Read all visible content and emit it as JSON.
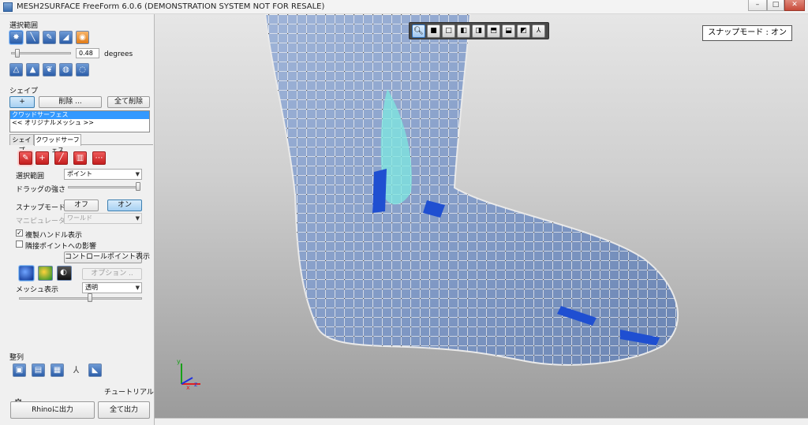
{
  "window": {
    "title": "MESH2SURFACE FreeForm 6.0.6 (DEMONSTRATION SYSTEM NOT FOR RESALE)",
    "controls": {
      "minimize": "–",
      "maximize": "□",
      "close": "✕"
    }
  },
  "panel": {
    "selection_range_label": "選択範囲",
    "selection_tools": [
      {
        "icon": "select-point-icon",
        "selected": true
      },
      {
        "icon": "select-edge-icon",
        "selected": false
      },
      {
        "icon": "select-brush-icon",
        "selected": false
      },
      {
        "icon": "select-region-icon",
        "selected": false
      },
      {
        "icon": "select-lasso-icon",
        "selected": false
      }
    ],
    "angle_value": "0.48",
    "angle_unit": "degrees",
    "angle_slider_position": 0.06,
    "mesh_tools": [
      {
        "icon": "triangle-outline-icon"
      },
      {
        "icon": "triangle-filled-icon"
      },
      {
        "icon": "bird-icon"
      },
      {
        "icon": "bulb-icon"
      },
      {
        "icon": "bulb-bright-icon"
      }
    ],
    "shape_section_label": "シェイプ",
    "add_label": "+",
    "delete_label": "削除 ...",
    "delete_all_label": "全て削除",
    "shapes_list": [
      {
        "label": "クワッドサーフェス",
        "selected": true
      },
      {
        "label": "<< オリジナルメッシュ >>",
        "selected": false
      }
    ],
    "tabs": [
      {
        "label": "シェイプ",
        "active": false
      },
      {
        "label": "クワッドサーフェス",
        "active": true
      }
    ],
    "quad_tools": [
      {
        "icon": "quad-brush-icon",
        "selected": true
      },
      {
        "icon": "quad-add-icon",
        "selected": false
      },
      {
        "icon": "quad-line-icon",
        "selected": false
      },
      {
        "icon": "quad-split-icon",
        "selected": false
      },
      {
        "icon": "quad-dots-icon",
        "selected": false
      }
    ],
    "selection_range": {
      "label": "選択範囲",
      "value": "ポイント"
    },
    "drag_strength": {
      "label": "ドラッグの強さ",
      "slider_position": 0.97
    },
    "snap_mode": {
      "label": "スナップモード",
      "off_label": "オフ",
      "on_label": "オン",
      "state": "on"
    },
    "manipulator": {
      "label": "マニピュレータ",
      "value": "ワールド"
    },
    "duplicate_handles": {
      "label": "複製ハンドル表示",
      "checked": true
    },
    "adjacent_points": {
      "label": "隣接ポイントへの影響",
      "checked": false
    },
    "control_points_button": "コントロールポイント表示",
    "display_modes": [
      {
        "icon": "shaded-sphere-icon",
        "selected": true
      },
      {
        "icon": "color-sphere-icon",
        "selected": false
      },
      {
        "icon": "wire-sphere-icon",
        "selected": false
      }
    ],
    "options_label": "オプション ..",
    "mesh_display": {
      "label": "メッシュ表示",
      "value": "透明",
      "slider_position": 0.58
    },
    "align_label": "整列",
    "align_tools": [
      {
        "icon": "align-front-icon"
      },
      {
        "icon": "align-side-icon"
      },
      {
        "icon": "align-top-icon"
      },
      {
        "icon": "align-axis-icon"
      },
      {
        "icon": "align-corner-icon"
      }
    ],
    "tutorial_label": "チュートリアル",
    "export_rhino_label": "Rhinoに出力",
    "export_all_label": "全て出力"
  },
  "viewport": {
    "snap_badge": "スナップモード : オン",
    "toolbar": [
      {
        "icon": "zoom-icon",
        "selected": true
      },
      {
        "icon": "view-front-icon"
      },
      {
        "icon": "view-back-icon"
      },
      {
        "icon": "view-left-icon"
      },
      {
        "icon": "view-right-icon"
      },
      {
        "icon": "view-top-icon"
      },
      {
        "icon": "view-bottom-icon"
      },
      {
        "icon": "view-iso-icon"
      },
      {
        "icon": "view-axes-icon"
      }
    ],
    "axes": {
      "y": "y",
      "x": "x",
      "z": "z"
    },
    "colors": {
      "mesh": "#8ea6cc",
      "grid": "#f5f5f5",
      "highlight": "#7de8e0",
      "selected": "#1f4fd1",
      "axis_x": "#e02020",
      "axis_y": "#18a018",
      "axis_z": "#2030e0"
    }
  }
}
